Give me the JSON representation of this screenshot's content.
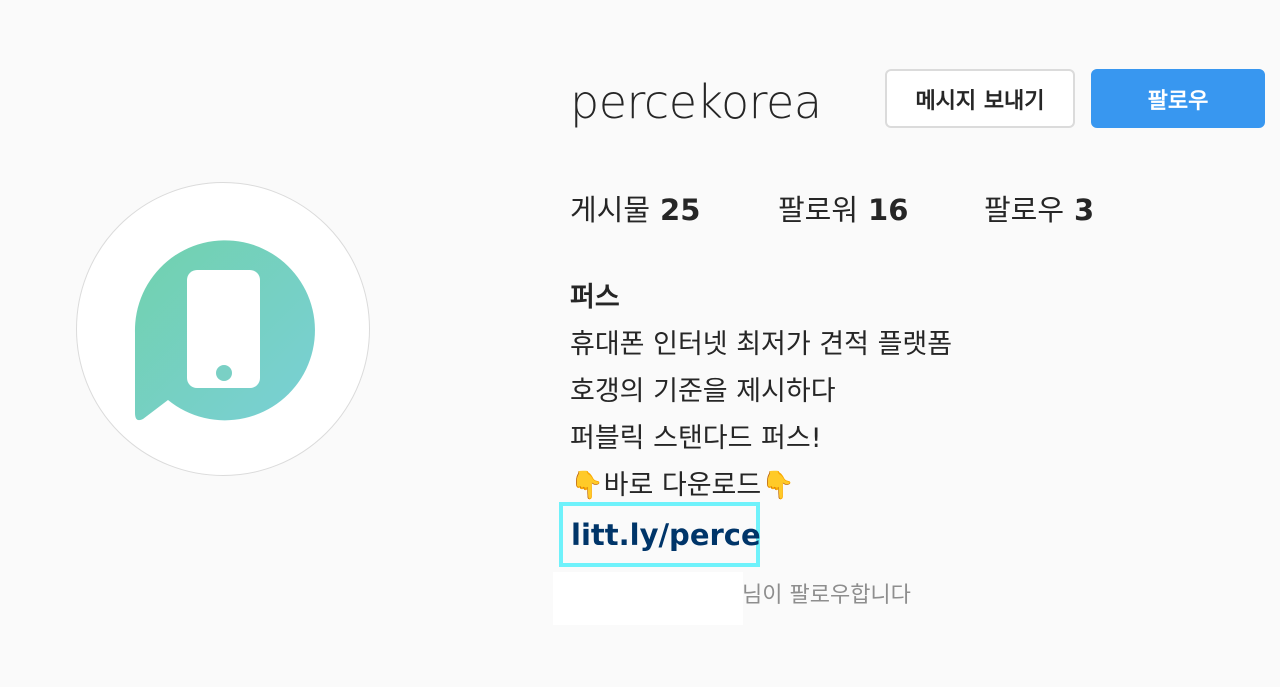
{
  "profile": {
    "username": "percekorea",
    "avatar_icon": "perce-logo-icon",
    "brand_color_start": "#6fd3b0",
    "brand_color_end": "#79d1d1"
  },
  "actions": {
    "message_label": "메시지 보내기",
    "follow_label": "팔로우"
  },
  "stats": {
    "posts_label": "게시물",
    "posts_count": "25",
    "followers_label": "팔로워",
    "followers_count": "16",
    "following_label": "팔로우",
    "following_count": "3"
  },
  "bio": {
    "name": "퍼스",
    "lines": [
      "휴대폰 인터넷 최저가 견적 플랫폼",
      "호갱의 기준을 제시하다",
      "퍼블릭 스탠다드 퍼스!",
      "👇바로 다운로드👇"
    ],
    "link": "litt.ly/perce",
    "followed_by_suffix": "님이 팔로우합니다"
  }
}
